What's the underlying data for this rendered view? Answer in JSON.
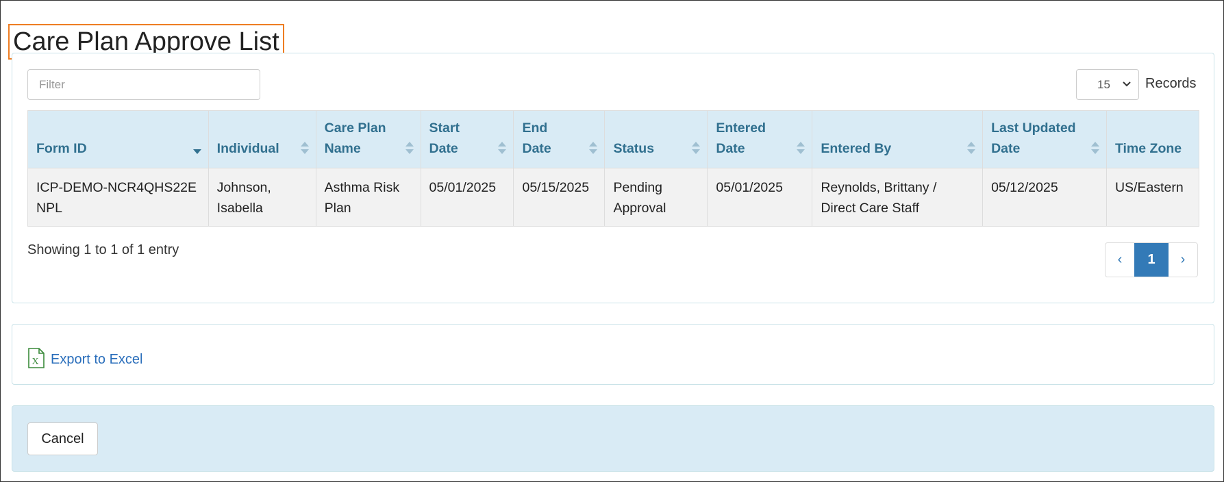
{
  "page": {
    "title": "Care Plan Approve List"
  },
  "filter": {
    "placeholder": "Filter"
  },
  "records": {
    "selected": "15",
    "label": "Records"
  },
  "table": {
    "columns": [
      "Form ID",
      "Individual",
      "Care Plan Name",
      "Start Date",
      "End Date",
      "Status",
      "Entered Date",
      "Entered By",
      "Last Updated Date",
      "Time Zone"
    ],
    "rows": [
      {
        "form_id": "ICP-DEMO-NCR4QHS22ENPL",
        "individual": "Johnson, Isabella",
        "care_plan_name": "Asthma Risk Plan",
        "start_date": "05/01/2025",
        "end_date": "05/15/2025",
        "status": "Pending Approval",
        "entered_date": "05/01/2025",
        "entered_by": "Reynolds, Brittany / Direct Care Staff",
        "last_updated_date": "05/12/2025",
        "time_zone": "US/Eastern"
      }
    ]
  },
  "pagination": {
    "info": "Showing 1 to 1 of 1 entry",
    "prev": "‹",
    "current": "1",
    "next": "›"
  },
  "export": {
    "label": "Export to Excel",
    "icon": "excel-file-icon"
  },
  "footer": {
    "cancel_label": "Cancel"
  },
  "colors": {
    "accent": "#337ab7",
    "header_bg": "#d9ebf5",
    "header_text": "#31708f",
    "title_outline": "#ee7d22"
  }
}
